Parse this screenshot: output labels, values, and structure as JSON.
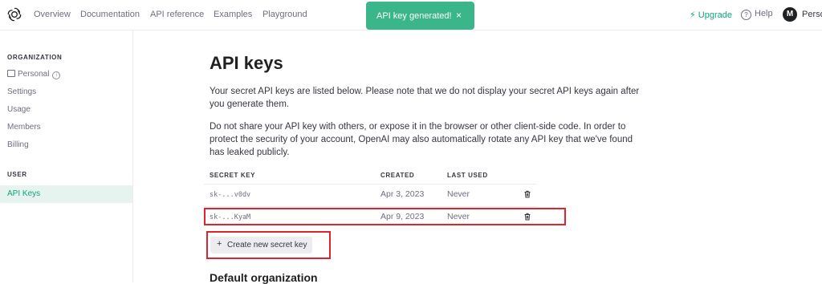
{
  "nav": {
    "links": [
      "Overview",
      "Documentation",
      "API reference",
      "Examples",
      "Playground"
    ],
    "upgrade_label": "Upgrade",
    "help_label": "Help",
    "avatar_initial": "M",
    "user_name": "Perso"
  },
  "toast": {
    "message": "API key generated!",
    "close": "×"
  },
  "sidebar": {
    "org_heading": "ORGANIZATION",
    "org_items": [
      "Personal",
      "Settings",
      "Usage",
      "Members",
      "Billing"
    ],
    "user_heading": "USER",
    "user_items": [
      "API Keys"
    ]
  },
  "main": {
    "title": "API keys",
    "para1": "Your secret API keys are listed below. Please note that we do not display your secret API keys again after you generate them.",
    "para2": "Do not share your API key with others, or expose it in the browser or other client-side code. In order to protect the security of your account, OpenAI may also automatically rotate any API key that we've found has leaked publicly.",
    "table": {
      "headers": [
        "SECRET KEY",
        "CREATED",
        "LAST USED"
      ],
      "rows": [
        {
          "key": "sk-...v0dv",
          "created": "Apr 3, 2023",
          "last_used": "Never"
        },
        {
          "key": "sk-...KyaM",
          "created": "Apr 9, 2023",
          "last_used": "Never"
        }
      ]
    },
    "create_button": "Create new secret key",
    "section_title": "Default organization"
  },
  "colors": {
    "accent": "#10a37f",
    "toast": "#3bb58a",
    "highlight": "#e0242f"
  }
}
